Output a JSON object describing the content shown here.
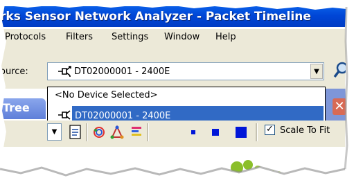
{
  "window": {
    "title": "rks Sensor Network Analyzer - Packet Timeline"
  },
  "menu": {
    "items": [
      "Protocols",
      "Filters",
      "Settings",
      "Window",
      "Help"
    ]
  },
  "source": {
    "label": "ource:",
    "selected_value": "DT02000001 - 2400E",
    "usb_icon": "usb-plug-icon"
  },
  "dropdown": {
    "options": [
      "<No Device Selected>",
      "DT02000001 - 2400E"
    ],
    "highlighted_index": 1
  },
  "panel": {
    "tab_label": "Tree"
  },
  "toolbar": {
    "scale_to_fit_label": "Scale To Fit",
    "scale_to_fit_checked": true,
    "check_mark": "✓"
  },
  "colors": {
    "title_bar": "#0046d6",
    "menu_bg": "#ece9d8",
    "selection": "#316ac5",
    "tab": "#6f8fe0",
    "close": "#d86a55",
    "logo_green": "#8bbf2a"
  }
}
